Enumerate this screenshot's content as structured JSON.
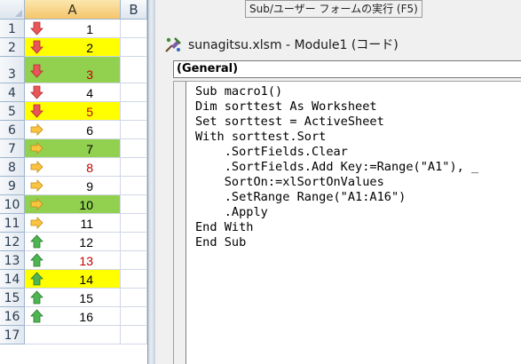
{
  "sheet": {
    "columns": [
      "A",
      "B"
    ],
    "rows": [
      {
        "num": "1",
        "value": "1",
        "icon": "red-down-arrow-icon",
        "fill": "",
        "text_color": "#000000"
      },
      {
        "num": "2",
        "value": "2",
        "icon": "red-down-arrow-icon",
        "fill": "#ffff00",
        "text_color": "#000000"
      },
      {
        "num": "3",
        "value": "3",
        "icon": "red-down-arrow-icon",
        "fill": "#92d050",
        "text_color": "#c00000"
      },
      {
        "num": "4",
        "value": "4",
        "icon": "red-down-arrow-icon",
        "fill": "",
        "text_color": "#000000"
      },
      {
        "num": "5",
        "value": "5",
        "icon": "red-down-arrow-icon",
        "fill": "#ffff00",
        "text_color": "#c00000"
      },
      {
        "num": "6",
        "value": "6",
        "icon": "yellow-right-arrow-icon",
        "fill": "",
        "text_color": "#000000"
      },
      {
        "num": "7",
        "value": "7",
        "icon": "yellow-right-arrow-icon",
        "fill": "#92d050",
        "text_color": "#000000"
      },
      {
        "num": "8",
        "value": "8",
        "icon": "yellow-right-arrow-icon",
        "fill": "",
        "text_color": "#c00000"
      },
      {
        "num": "9",
        "value": "9",
        "icon": "yellow-right-arrow-icon",
        "fill": "",
        "text_color": "#000000"
      },
      {
        "num": "10",
        "value": "10",
        "icon": "yellow-right-arrow-icon",
        "fill": "#92d050",
        "text_color": "#000000"
      },
      {
        "num": "11",
        "value": "11",
        "icon": "yellow-right-arrow-icon",
        "fill": "",
        "text_color": "#000000"
      },
      {
        "num": "12",
        "value": "12",
        "icon": "green-up-arrow-icon",
        "fill": "",
        "text_color": "#000000"
      },
      {
        "num": "13",
        "value": "13",
        "icon": "green-up-arrow-icon",
        "fill": "",
        "text_color": "#c00000"
      },
      {
        "num": "14",
        "value": "14",
        "icon": "green-up-arrow-icon",
        "fill": "#ffff00",
        "text_color": "#000000"
      },
      {
        "num": "15",
        "value": "15",
        "icon": "green-up-arrow-icon",
        "fill": "",
        "text_color": "#000000"
      },
      {
        "num": "16",
        "value": "16",
        "icon": "green-up-arrow-icon",
        "fill": "",
        "text_color": "#000000"
      },
      {
        "num": "17",
        "value": "",
        "icon": "",
        "fill": "",
        "text_color": "#000000"
      }
    ]
  },
  "tooltip": "Sub/ユーザー フォームの実行 (F5)",
  "code_window": {
    "title": "sunagitsu.xlsm - Module1 (コード)",
    "object_combo": "(General)",
    "code": "Sub macro1()\nDim sorttest As Worksheet\nSet sorttest = ActiveSheet\nWith sorttest.Sort\n    .SortFields.Clear\n    .SortFields.Add Key:=Range(\"A1\"), _\n    SortOn:=xlSortOnValues\n    .SetRange Range(\"A1:A16\")\n    .Apply\nEnd With\nEnd Sub"
  }
}
